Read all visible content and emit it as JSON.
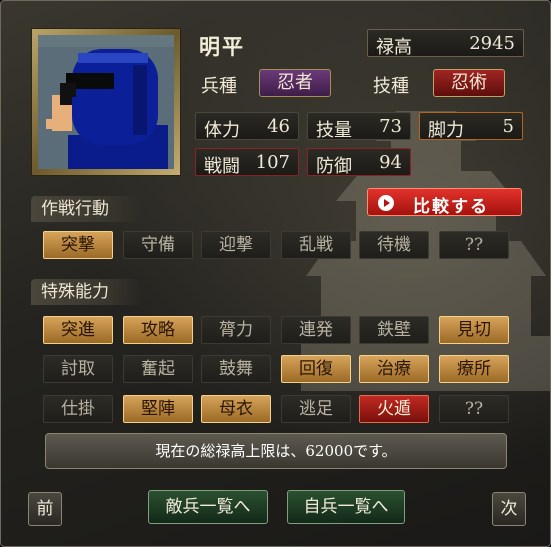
{
  "unit": {
    "name": "明平",
    "stipend_label": "禄高",
    "stipend_value": "2945",
    "troop_type_label": "兵種",
    "troop_type_value": "忍者",
    "skill_type_label": "技種",
    "skill_type_value": "忍術",
    "stats": [
      {
        "label": "体力",
        "value": "46"
      },
      {
        "label": "技量",
        "value": "73"
      },
      {
        "label": "脚力",
        "value": "5"
      },
      {
        "label": "戦闘",
        "value": "107"
      },
      {
        "label": "防御",
        "value": "94"
      }
    ]
  },
  "compare_button": "比較する",
  "tactics": {
    "header": "作戦行動",
    "items": [
      "突撃",
      "守備",
      "迎撃",
      "乱戦",
      "待機",
      "??"
    ]
  },
  "abilities": {
    "header": "特殊能力",
    "rows": [
      [
        "突進",
        "攻略",
        "膂力",
        "連発",
        "鉄壁",
        "見切"
      ],
      [
        "討取",
        "奮起",
        "鼓舞",
        "回復",
        "治療",
        "療所"
      ],
      [
        "仕掛",
        "堅陣",
        "母衣",
        "逃足",
        "火遁",
        "??"
      ]
    ]
  },
  "message": "現在の総禄高上限は、62000です。",
  "nav": {
    "prev": "前",
    "enemy_list": "敵兵一覧へ",
    "own_list": "自兵一覧へ",
    "next": "次"
  },
  "colors": {
    "active_gold": "#d7a35a",
    "active_red": "#c22a22",
    "purple_tag": "#6b3a78",
    "compare_red": "#e2322c"
  }
}
